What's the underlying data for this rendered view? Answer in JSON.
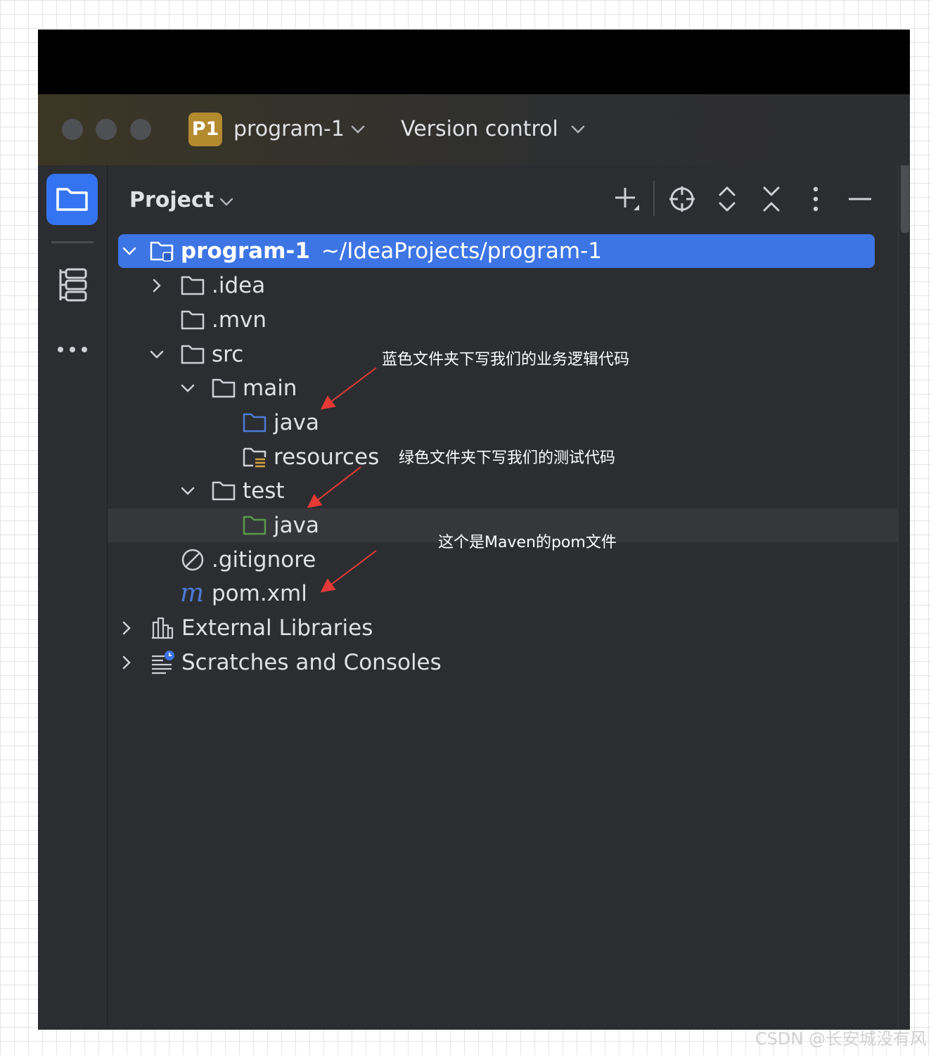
{
  "window": {
    "project_badge": "P1",
    "project_name": "program-1",
    "vcs_menu": "Version control"
  },
  "sidebar": {
    "items": [
      {
        "name": "project-view",
        "icon": "folder-icon",
        "active": true
      },
      {
        "name": "structure-view",
        "icon": "structure-icon",
        "active": false
      },
      {
        "name": "more",
        "icon": "more-icon",
        "active": false
      }
    ]
  },
  "panel": {
    "title": "Project",
    "toolbar": [
      "add-icon",
      "locate-icon",
      "expand-all-icon",
      "collapse-all-icon",
      "options-icon",
      "hide-icon"
    ]
  },
  "tree": [
    {
      "label": "program-1",
      "path": "~/IdeaProjects/program-1",
      "icon": "module-folder-icon",
      "expanded": true,
      "selected": true
    },
    {
      "label": ".idea",
      "icon": "folder-icon",
      "expanded": false
    },
    {
      "label": ".mvn",
      "icon": "folder-icon"
    },
    {
      "label": "src",
      "icon": "folder-icon",
      "expanded": true
    },
    {
      "label": "main",
      "icon": "folder-icon",
      "expanded": true
    },
    {
      "label": "java",
      "icon": "source-folder-icon",
      "color": "#4b7bd8"
    },
    {
      "label": "resources",
      "icon": "resources-folder-icon"
    },
    {
      "label": "test",
      "icon": "folder-icon",
      "expanded": true
    },
    {
      "label": "java",
      "icon": "test-folder-icon",
      "color": "#5a9a4b"
    },
    {
      "label": ".gitignore",
      "icon": "ignore-file-icon"
    },
    {
      "label": "pom.xml",
      "icon": "maven-icon"
    },
    {
      "label": "External Libraries",
      "icon": "library-icon",
      "expanded": false
    },
    {
      "label": "Scratches and Consoles",
      "icon": "scratches-icon",
      "expanded": false
    }
  ],
  "annotations": [
    "蓝色文件夹下写我们的业务逻辑代码",
    "绿色文件夹下写我们的测试代码",
    "这个是Maven的pom文件"
  ],
  "watermark": "CSDN @长安城没有风",
  "colors": {
    "accent": "#3574f0",
    "selection": "#3d75e5",
    "arrow": "#e53935",
    "badge": "#b48a2f"
  }
}
